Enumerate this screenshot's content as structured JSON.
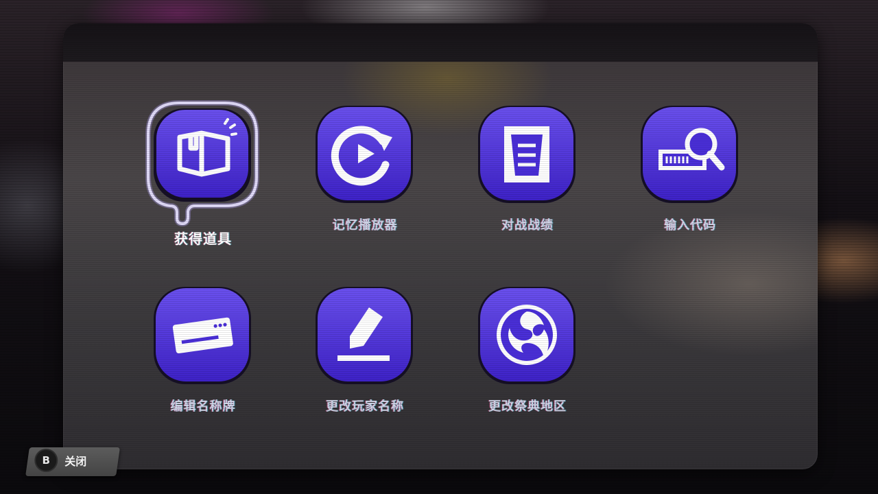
{
  "menu": {
    "items": [
      {
        "label": "获得道具",
        "icon": "package-icon",
        "selected": true
      },
      {
        "label": "记忆播放器",
        "icon": "replay-icon",
        "selected": false
      },
      {
        "label": "对战战绩",
        "icon": "clipboard-icon",
        "selected": false
      },
      {
        "label": "输入代码",
        "icon": "code-search-icon",
        "selected": false
      },
      {
        "label": "编辑名称牌",
        "icon": "nameplate-icon",
        "selected": false
      },
      {
        "label": "更改玩家名称",
        "icon": "pencil-icon",
        "selected": false
      },
      {
        "label": "更改祭典地区",
        "icon": "splatfest-emblem-icon",
        "selected": false
      }
    ]
  },
  "footer": {
    "close_button_key": "B",
    "close_label": "关闭"
  },
  "colors": {
    "tile_purple": "#4a2fd8",
    "tile_purple_light": "#5d45e8",
    "selected_glow": "#ffffff"
  }
}
